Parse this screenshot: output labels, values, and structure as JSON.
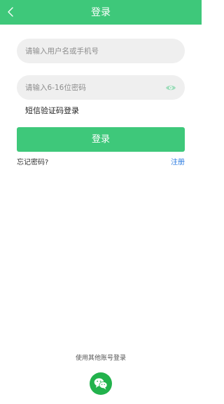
{
  "header": {
    "title": "登录",
    "back_icon": "chevron-left-icon"
  },
  "form": {
    "username": {
      "placeholder": "请输入用户名或手机号",
      "value": ""
    },
    "password": {
      "placeholder": "请输入6-16位密码",
      "value": "",
      "toggle_icon": "eye-icon"
    },
    "sms_login_label": "短信验证码登录",
    "login_label": "登录",
    "forgot_label": "忘记密码?",
    "register_label": "注册"
  },
  "footer": {
    "other_login_label": "使用其他账号登录",
    "wechat_icon": "wechat-icon"
  },
  "colors": {
    "brand": "#3ec87a",
    "link": "#2b7be0",
    "wechat": "#22b24c",
    "field_bg": "#efefef"
  }
}
